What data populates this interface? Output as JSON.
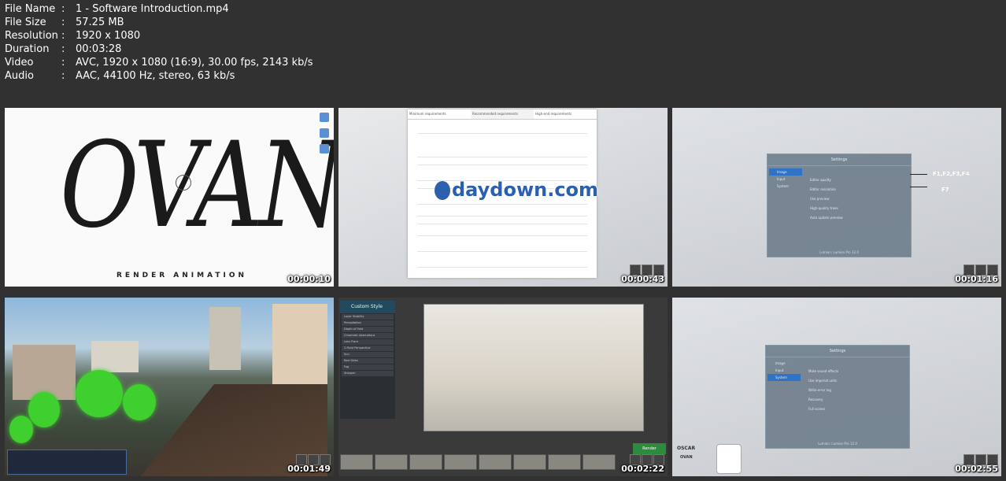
{
  "file_info": [
    {
      "key": "File Name",
      "value": "1 - Software Introduction.mp4"
    },
    {
      "key": "File Size",
      "value": "57.25 MB"
    },
    {
      "key": "Resolution",
      "value": "1920 x 1080"
    },
    {
      "key": "Duration",
      "value": "00:03:28"
    },
    {
      "key": "Video",
      "value": "AVC, 1920 x 1080 (16:9), 30.00 fps, 2143 kb/s"
    },
    {
      "key": "Audio",
      "value": "AAC, 44100 Hz, stereo, 63 kb/s"
    }
  ],
  "separator": ":",
  "thumbnails": [
    {
      "timestamp": "00:00:10",
      "logo_text": "OVAN",
      "tagline": "RENDER ANIMATION"
    },
    {
      "timestamp": "00:00:43",
      "tabs": [
        "Minimum requirements",
        "Recommended requirements",
        "High-end requirements"
      ],
      "watermark": "daydown.com"
    },
    {
      "timestamp": "00:01:16",
      "settings_title": "Settings",
      "menu": [
        "Image",
        "Input",
        "System"
      ],
      "options": [
        "Editor quality",
        "Editor resolution",
        "Use preview",
        "High-quality trees",
        "Auto update preview"
      ],
      "footer": "Lumion: Lumion Pro 12.0",
      "labels": [
        "F1,F2,F3,F4",
        "F7"
      ]
    },
    {
      "timestamp": "00:01:49"
    },
    {
      "timestamp": "00:02:22",
      "panel_title": "Custom Style",
      "panel_items": [
        "Layer Visibility",
        "Precipitation",
        "Depth of Field",
        "Chromatic Aberrations",
        "Lens Flare",
        "2-Point Perspective",
        "Sun",
        "Real Skies",
        "Fog",
        "Sharpen"
      ],
      "render_label": "Render"
    },
    {
      "timestamp": "00:02:55",
      "settings_title": "Settings",
      "menu": [
        "Image",
        "Input",
        "System"
      ],
      "options": [
        "Mute sound effects",
        "Use imperial units",
        "Write error log",
        "Recovery",
        "Full screen"
      ],
      "footer": "Lumion: Lumion Pro 12.0",
      "presenter_name": "OSCAR",
      "presenter_brand": "OVAN"
    }
  ]
}
